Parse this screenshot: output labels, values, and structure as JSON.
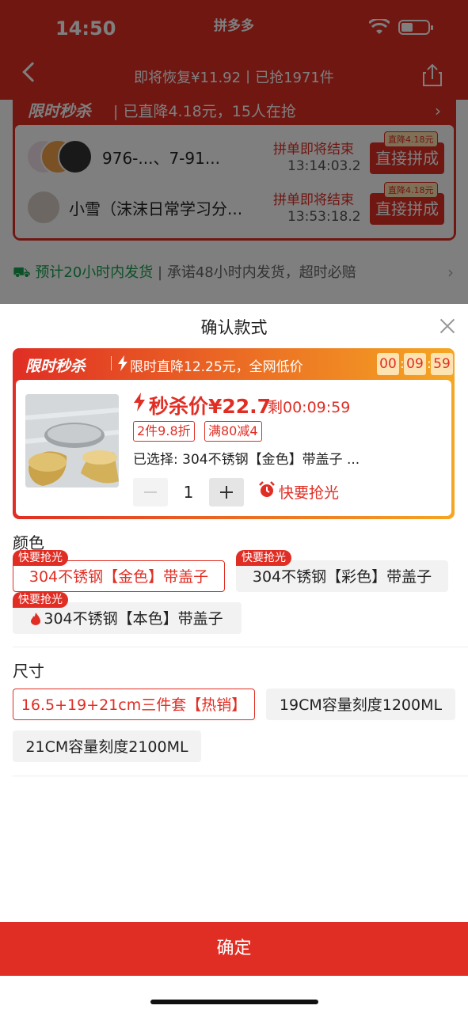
{
  "status_bar": {
    "time": "14:50",
    "app_name": "拼多多"
  },
  "nav": {
    "info": "即将恢复¥11.92丨已抢1971件"
  },
  "flash_strip": {
    "logo": "限时秒杀",
    "text": "| 已直降4.18元，15人在抢",
    "groups": [
      {
        "name": "976-...、7-91...",
        "status": "拼单即将结束",
        "time": "13:14:03.2",
        "tag": "直降4.18元",
        "button": "直接拼成"
      },
      {
        "name": "小雪（沫沫日常学习分...",
        "status": "拼单即将结束",
        "time": "13:53:18.2",
        "tag": "直降4.18元",
        "button": "直接拼成"
      }
    ]
  },
  "shipping": {
    "highlight": "预计20小时内发货",
    "detail": "承诺48小时内发货，超时必赔"
  },
  "sheet": {
    "title": "确认款式",
    "promo": {
      "logo": "限时秒杀",
      "text": "限时直降12.25元，全网低价",
      "countdown": [
        "00",
        "09",
        "59"
      ],
      "price": "秒杀价¥22.7",
      "remaining": "剩00:09:59",
      "tags": [
        "2件9.8折",
        "满80减4"
      ],
      "selected": "已选择: 304不锈钢【金色】带盖子 ...",
      "quantity": "1",
      "hurry": "快要抢光"
    },
    "color": {
      "label": "颜色",
      "options": [
        {
          "label": "304不锈钢【金色】带盖子",
          "badge": "快要抢光",
          "selected": true
        },
        {
          "label": "304不锈钢【彩色】带盖子",
          "badge": "快要抢光",
          "selected": false
        },
        {
          "label": "304不锈钢【本色】带盖子",
          "badge": "快要抢光",
          "selected": false,
          "icon": "flame-icon"
        }
      ]
    },
    "size": {
      "label": "尺寸",
      "options": [
        {
          "label": "16.5+19+21cm三件套【热销】",
          "selected": true
        },
        {
          "label": "19CM容量刻度1200ML",
          "selected": false
        },
        {
          "label": "21CM容量刻度2100ML",
          "selected": false
        }
      ]
    },
    "confirm": "确定"
  },
  "colors": {
    "accent": "#e02e24",
    "ship_green": "#16a14c",
    "tag_bg": "#fde3b1"
  }
}
